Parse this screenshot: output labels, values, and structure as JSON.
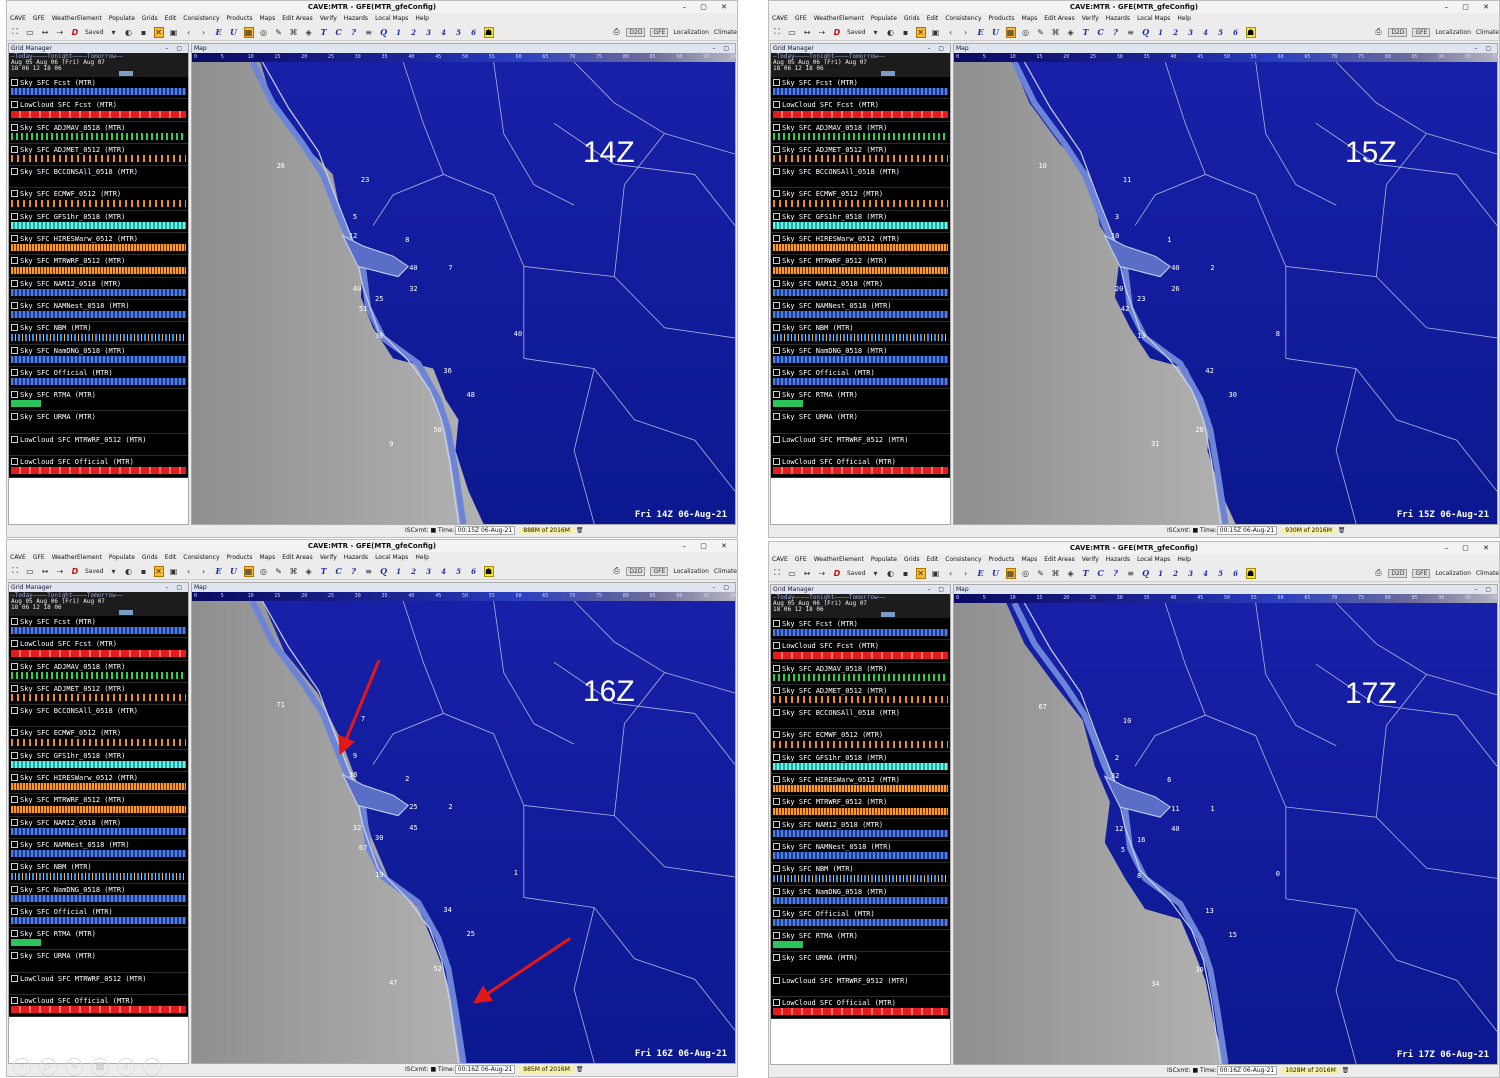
{
  "window": {
    "title": "CAVE:MTR - GFE(MTR_gfeConfig)",
    "controls": "–  ▢  ✕"
  },
  "menu": [
    "CAVE",
    "GFE",
    "WeatherElement",
    "Populate",
    "Grids",
    "Edit",
    "Consistency",
    "Products",
    "Maps",
    "Edit Areas",
    "Verify",
    "Hazards",
    "Local Maps",
    "Help"
  ],
  "toolbar": {
    "saved_label": "Saved",
    "letters": [
      "E",
      "U"
    ],
    "red_letter": "D",
    "tools2": [
      "T",
      "C",
      "?"
    ],
    "q": "Q",
    "numbers": [
      "1",
      "2",
      "3",
      "4",
      "5",
      "6"
    ],
    "d2d": "D2D",
    "gfe": "GFE",
    "localization": "Localization",
    "climate": "Climate"
  },
  "grid_manager": {
    "title": "Grid Manager",
    "map_title": "Map",
    "header_top": "—Today————Tonight————Tomorrow——",
    "header_dates": "Aug 05      Aug 06 (Fri)       Aug 07",
    "header_hours": "18      06      12      18      06",
    "rows": [
      {
        "label": "Sky SFC  Fcst (MTR)",
        "bar": "blue"
      },
      {
        "label": "LowCloud SFC  Fcst (MTR)",
        "bar": "red"
      },
      {
        "label": "Sky SFC  ADJMAV_0518 (MTR)",
        "bar": "green"
      },
      {
        "label": "Sky SFC  ADJMET_0512 (MTR)",
        "bar": "orange"
      },
      {
        "label": "Sky SFC  BCCONSAll_0518 (MTR)",
        "bar": "none"
      },
      {
        "label": "Sky SFC  ECMWF_0512 (MTR)",
        "bar": "orange"
      },
      {
        "label": "Sky SFC  GFS1hr_0518 (MTR)",
        "bar": "cyan"
      },
      {
        "label": "Sky SFC  HIRESWarw_0512 (MTR)",
        "bar": "orangedense"
      },
      {
        "label": "Sky SFC  MTRWRF_0512 (MTR)",
        "bar": "orangedense"
      },
      {
        "label": "Sky SFC  NAM12_0518 (MTR)",
        "bar": "blue"
      },
      {
        "label": "Sky SFC  NAMNest_0518 (MTR)",
        "bar": "blue"
      },
      {
        "label": "Sky SFC  NBM (MTR)",
        "bar": "mixed"
      },
      {
        "label": "Sky SFC  NamDNG_0518 (MTR)",
        "bar": "blue"
      },
      {
        "label": "Sky SFC  Official (MTR)",
        "bar": "blue"
      },
      {
        "label": "Sky SFC  RTMA (MTR)",
        "bar": "short"
      },
      {
        "label": "Sky SFC  URMA (MTR)",
        "bar": "none"
      },
      {
        "label": "LowCloud SFC  MTRWRF_0512 (MTR)",
        "bar": "none"
      },
      {
        "label": "LowCloud SFC  Official (MTR)",
        "bar": "red"
      }
    ]
  },
  "scale_ticks": [
    "0",
    "5",
    "10",
    "15",
    "20",
    "25",
    "30",
    "35",
    "40",
    "45",
    "50",
    "55",
    "60",
    "65",
    "70",
    "75",
    "80",
    "85",
    "90",
    "95",
    "100"
  ],
  "status": {
    "iscxmt": "ISCxmt:",
    "time_label": "Time:"
  },
  "panels": [
    {
      "label": "14Z",
      "timestamp": "Fri 14Z 06-Aug-21",
      "time_value": "00:15Z 06-Aug-21",
      "memory": "888M of 2016M",
      "values": [
        "26",
        "23",
        "5",
        "12",
        "8",
        "40",
        "7",
        "40",
        "32",
        "25",
        "51",
        "36",
        "40",
        "36",
        "48",
        "50",
        "9"
      ]
    },
    {
      "label": "15Z",
      "timestamp": "Fri 15Z 06-Aug-21",
      "time_value": "00:15Z 06-Aug-21",
      "memory": "930M of 2016M",
      "values": [
        "10",
        "11",
        "3",
        "10",
        "1",
        "40",
        "2",
        "20",
        "26",
        "23",
        "42",
        "13",
        "8",
        "42",
        "30",
        "28",
        "31"
      ]
    },
    {
      "label": "16Z",
      "timestamp": "Fri 16Z 06-Aug-21",
      "time_value": "00:16Z 06-Aug-21",
      "memory": "985M of 2016M",
      "values": [
        "71",
        "7",
        "9",
        "38",
        "2",
        "25",
        "2",
        "32",
        "45",
        "30",
        "67",
        "19",
        "1",
        "34",
        "25",
        "52",
        "47"
      ]
    },
    {
      "label": "17Z",
      "timestamp": "Fri 17Z 06-Aug-21",
      "time_value": "00:16Z 06-Aug-21",
      "memory": "1028M of 2016M",
      "values": [
        "67",
        "10",
        "2",
        "32",
        "6",
        "11",
        "1",
        "12",
        "40",
        "16",
        "5",
        "8",
        "0",
        "13",
        "15",
        "30",
        "34"
      ]
    }
  ]
}
